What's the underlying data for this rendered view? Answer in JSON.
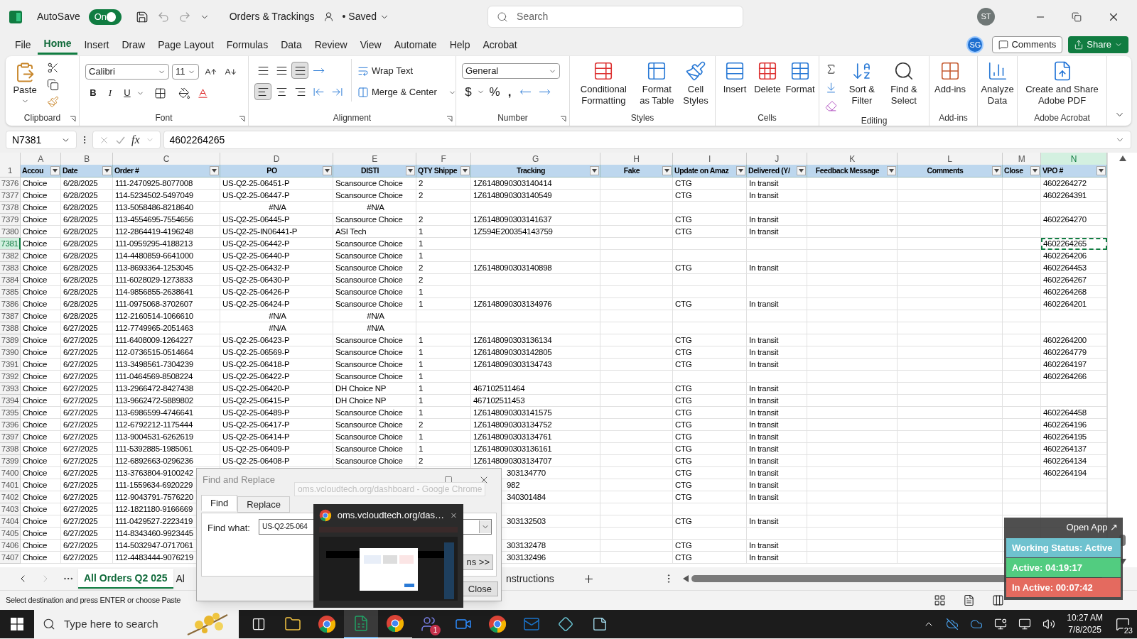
{
  "title_bar": {
    "autosave_label": "AutoSave",
    "autosave": {
      "label": "On",
      "on": true
    },
    "document_title": "Orders & Trackings",
    "save_status": "• Saved",
    "search": {
      "placeholder": "Search"
    },
    "user_initials": "ST"
  },
  "menu_tabs": [
    {
      "label": "File",
      "selected": false
    },
    {
      "label": "Home",
      "selected": true
    },
    {
      "label": "Insert",
      "selected": false
    },
    {
      "label": "Draw",
      "selected": false
    },
    {
      "label": "Page Layout",
      "selected": false
    },
    {
      "label": "Formulas",
      "selected": false
    },
    {
      "label": "Data",
      "selected": false
    },
    {
      "label": "Review",
      "selected": false
    },
    {
      "label": "View",
      "selected": false
    },
    {
      "label": "Automate",
      "selected": false
    },
    {
      "label": "Help",
      "selected": false
    },
    {
      "label": "Acrobat",
      "selected": false
    }
  ],
  "account": {
    "initials": "SG",
    "comments_button": "Comments",
    "share_button": "Share"
  },
  "ribbon": {
    "clipboard": {
      "label": "Clipboard",
      "paste": "Paste"
    },
    "font": {
      "label": "Font",
      "name": "Calibri",
      "size": "11",
      "bold": "B",
      "italic": "I",
      "underline": "U"
    },
    "alignment": {
      "label": "Alignment",
      "wrap_text": "Wrap Text",
      "merge": "Merge & Center"
    },
    "number": {
      "label": "Number",
      "format": "General",
      "currency": "$",
      "percent": "%",
      "comma": ","
    },
    "groups": [
      {
        "label": "Styles",
        "buttons": [
          "Conditional Formatting",
          "Format as Table",
          "Cell Styles"
        ]
      },
      {
        "label": "Cells",
        "buttons": [
          "Insert",
          "Delete",
          "Format"
        ]
      },
      {
        "label": "Editing",
        "buttons": [
          "Sort & Filter",
          "Find & Select"
        ]
      },
      {
        "label": "Add-ins",
        "buttons": [
          "Add-ins"
        ]
      },
      {
        "buttons": [
          "Analyze Data"
        ]
      },
      {
        "label": "Adobe Acrobat",
        "buttons": [
          "Create and Share Adobe PDF"
        ]
      }
    ]
  },
  "formula_bar": {
    "name_box": "N7381",
    "function_label": "fx",
    "value": "4602264265"
  },
  "sheet": {
    "header_row": "1",
    "columns": [
      {
        "letter": "A",
        "header": "Accou"
      },
      {
        "letter": "B",
        "header": "Date"
      },
      {
        "letter": "C",
        "header": "Order #"
      },
      {
        "letter": "D",
        "header": "PO"
      },
      {
        "letter": "E",
        "header": "DISTI"
      },
      {
        "letter": "F",
        "header": "QTY Shippe"
      },
      {
        "letter": "G",
        "header": "Tracking"
      },
      {
        "letter": "H",
        "header": "Fake"
      },
      {
        "letter": "I",
        "header": "Update on Amaz"
      },
      {
        "letter": "J",
        "header": "Delivered (Y/"
      },
      {
        "letter": "K",
        "header": "Feedback Message"
      },
      {
        "letter": "L",
        "header": "Comments"
      },
      {
        "letter": "M",
        "header": "Close"
      },
      {
        "letter": "N",
        "header": "VPO #"
      }
    ],
    "rows": [
      {
        "num": "7376",
        "kind": "normal",
        "selected": false,
        "cells": [
          "Choice",
          "6/28/2025",
          "111-2470925-8077008",
          "US-Q2-25-06451-P",
          "Scansource Choice",
          "2",
          "1Z6148090303140414",
          null,
          "CTG",
          "In transit",
          null,
          null,
          null,
          "4602264272"
        ]
      },
      {
        "num": "7377",
        "kind": "normal",
        "selected": false,
        "cells": [
          "Choice",
          "6/28/2025",
          "114-5234502-5497049",
          "US-Q2-25-06447-P",
          "Scansource Choice",
          "2",
          "1Z6148090303140549",
          null,
          "CTG",
          "In transit",
          null,
          null,
          null,
          "4602264391"
        ]
      },
      {
        "num": "7378",
        "kind": "na",
        "selected": false,
        "cells": [
          "Choice",
          "6/28/2025",
          "113-5058486-8218640",
          "#N/A",
          "#N/A",
          null,
          null,
          null,
          null,
          null,
          null,
          null,
          null,
          null
        ]
      },
      {
        "num": "7379",
        "kind": "normal",
        "selected": false,
        "cells": [
          "Choice",
          "6/28/2025",
          "113-4554695-7554656",
          "US-Q2-25-06445-P",
          "Scansource Choice",
          "2",
          "1Z6148090303141637",
          null,
          "CTG",
          "In transit",
          null,
          null,
          null,
          "4602264270"
        ]
      },
      {
        "num": "7380",
        "kind": "normal",
        "selected": false,
        "cells": [
          "Choice",
          "6/28/2025",
          "112-2864419-4196248",
          "US-Q2-25-IN06441-P",
          "ASI Tech",
          "1",
          "1Z594E200354143759",
          null,
          "CTG",
          "In transit",
          null,
          null,
          null,
          null
        ]
      },
      {
        "num": "7381",
        "kind": "normal",
        "selected": true,
        "cells": [
          "Choice",
          "6/28/2025",
          "111-0959295-4188213",
          "US-Q2-25-06442-P",
          "Scansource Choice",
          "1",
          null,
          null,
          null,
          null,
          null,
          null,
          null,
          "4602264265"
        ]
      },
      {
        "num": "7382",
        "kind": "normal",
        "selected": false,
        "cells": [
          "Choice",
          "6/28/2025",
          "114-4480859-6641000",
          "US-Q2-25-06440-P",
          "Scansource Choice",
          "1",
          null,
          null,
          null,
          null,
          null,
          null,
          null,
          "4602264206"
        ]
      },
      {
        "num": "7383",
        "kind": "normal",
        "selected": false,
        "cells": [
          "Choice",
          "6/28/2025",
          "113-8693364-1253045",
          "US-Q2-25-06432-P",
          "Scansource Choice",
          "2",
          "1Z6148090303140898",
          null,
          "CTG",
          "In transit",
          null,
          null,
          null,
          "4602264453"
        ]
      },
      {
        "num": "7384",
        "kind": "normal",
        "selected": false,
        "cells": [
          "Choice",
          "6/28/2025",
          "111-6028029-1273833",
          "US-Q2-25-06430-P",
          "Scansource Choice",
          "2",
          null,
          null,
          null,
          null,
          null,
          null,
          null,
          "4602264267"
        ]
      },
      {
        "num": "7385",
        "kind": "normal",
        "selected": false,
        "cells": [
          "Choice",
          "6/28/2025",
          "114-9856855-2638641",
          "US-Q2-25-06426-P",
          "Scansource Choice",
          "1",
          null,
          null,
          null,
          null,
          null,
          null,
          null,
          "4602264268"
        ]
      },
      {
        "num": "7386",
        "kind": "normal",
        "selected": false,
        "cells": [
          "Choice",
          "6/28/2025",
          "111-0975068-3702607",
          "US-Q2-25-06424-P",
          "Scansource Choice",
          "1",
          "1Z6148090303134976",
          null,
          "CTG",
          "In transit",
          null,
          null,
          null,
          "4602264201"
        ]
      },
      {
        "num": "7387",
        "kind": "na",
        "selected": false,
        "cells": [
          "Choice",
          "6/28/2025",
          "112-2160514-1066610",
          "#N/A",
          "#N/A",
          null,
          null,
          null,
          null,
          null,
          null,
          null,
          null,
          null
        ]
      },
      {
        "num": "7388",
        "kind": "na",
        "selected": false,
        "cells": [
          "Choice",
          "6/27/2025",
          "112-7749965-2051463",
          "#N/A",
          "#N/A",
          null,
          null,
          null,
          null,
          null,
          null,
          null,
          null,
          null
        ]
      },
      {
        "num": "7389",
        "kind": "normal",
        "selected": false,
        "cells": [
          "Choice",
          "6/27/2025",
          "111-6408009-1264227",
          "US-Q2-25-06423-P",
          "Scansource Choice",
          "1",
          "1Z6148090303136134",
          null,
          "CTG",
          "In transit",
          null,
          null,
          null,
          "4602264200"
        ]
      },
      {
        "num": "7390",
        "kind": "normal",
        "selected": false,
        "cells": [
          "Choice",
          "6/27/2025",
          "112-0736515-0514664",
          "US-Q2-25-06569-P",
          "Scansource Choice",
          "1",
          "1Z6148090303142805",
          null,
          "CTG",
          "In transit",
          null,
          null,
          null,
          "4602264779"
        ]
      },
      {
        "num": "7391",
        "kind": "normal",
        "selected": false,
        "cells": [
          "Choice",
          "6/27/2025",
          "113-3498561-7304239",
          "US-Q2-25-06418-P",
          "Scansource Choice",
          "1",
          "1Z6148090303134743",
          null,
          "CTG",
          "In transit",
          null,
          null,
          null,
          "4602264197"
        ]
      },
      {
        "num": "7392",
        "kind": "normal",
        "selected": false,
        "cells": [
          "Choice",
          "6/27/2025",
          "111-0464569-8508224",
          "US-Q2-25-06422-P",
          "Scansource Choice",
          "1",
          null,
          null,
          null,
          null,
          null,
          null,
          null,
          "4602264266"
        ]
      },
      {
        "num": "7393",
        "kind": "normal",
        "selected": false,
        "cells": [
          "Choice",
          "6/27/2025",
          "113-2966472-8427438",
          "US-Q2-25-06420-P",
          "DH Choice NP",
          "1",
          "467102511464",
          null,
          "CTG",
          "In transit",
          null,
          null,
          null,
          null
        ]
      },
      {
        "num": "7394",
        "kind": "normal",
        "selected": false,
        "cells": [
          "Choice",
          "6/27/2025",
          "113-9662472-5889802",
          "US-Q2-25-06415-P",
          "DH Choice NP",
          "1",
          "467102511453",
          null,
          "CTG",
          "In transit",
          null,
          null,
          null,
          null
        ]
      },
      {
        "num": "7395",
        "kind": "normal",
        "selected": false,
        "cells": [
          "Choice",
          "6/27/2025",
          "113-6986599-4746641",
          "US-Q2-25-06489-P",
          "Scansource Choice",
          "1",
          "1Z6148090303141575",
          null,
          "CTG",
          "In transit",
          null,
          null,
          null,
          "4602264458"
        ]
      },
      {
        "num": "7396",
        "kind": "normal",
        "selected": false,
        "cells": [
          "Choice",
          "6/27/2025",
          "112-6792212-1175444",
          "US-Q2-25-06417-P",
          "Scansource Choice",
          "2",
          "1Z6148090303134752",
          null,
          "CTG",
          "In transit",
          null,
          null,
          null,
          "4602264196"
        ]
      },
      {
        "num": "7397",
        "kind": "normal",
        "selected": false,
        "cells": [
          "Choice",
          "6/27/2025",
          "113-9004531-6262619",
          "US-Q2-25-06414-P",
          "Scansource Choice",
          "1",
          "1Z6148090303134761",
          null,
          "CTG",
          "In transit",
          null,
          null,
          null,
          "4602264195"
        ]
      },
      {
        "num": "7398",
        "kind": "normal",
        "selected": false,
        "cells": [
          "Choice",
          "6/27/2025",
          "111-5392885-1985061",
          "US-Q2-25-06409-P",
          "Scansource Choice",
          "1",
          "1Z6148090303136161",
          null,
          "CTG",
          "In transit",
          null,
          null,
          null,
          "4602264137"
        ]
      },
      {
        "num": "7399",
        "kind": "normal",
        "selected": false,
        "cells": [
          "Choice",
          "6/27/2025",
          "112-6892663-0296236",
          "US-Q2-25-06408-P",
          "Scansource Choice",
          "2",
          "1Z6148090303134707",
          null,
          "CTG",
          "In transit",
          null,
          null,
          null,
          "4602264134"
        ]
      },
      {
        "num": "7400",
        "kind": "covered",
        "selected": false,
        "cells": [
          "Choice",
          "6/27/2025",
          "113-3763804-9100242",
          null,
          null,
          null,
          "303134770",
          null,
          "CTG",
          "In transit",
          null,
          null,
          null,
          "4602264194"
        ]
      },
      {
        "num": "7401",
        "kind": "covered",
        "selected": false,
        "cells": [
          "Choice",
          "6/27/2025",
          "111-1559634-6920229",
          null,
          null,
          null,
          "982",
          null,
          "CTG",
          "In transit",
          null,
          null,
          null,
          null
        ]
      },
      {
        "num": "7402",
        "kind": "covered",
        "selected": false,
        "cells": [
          "Choice",
          "6/27/2025",
          "112-9043791-7576220",
          null,
          null,
          null,
          "340301484",
          null,
          "CTG",
          "In transit",
          null,
          null,
          null,
          null
        ]
      },
      {
        "num": "7403",
        "kind": "covered",
        "selected": false,
        "cells": [
          "Choice",
          "6/27/2025",
          "112-1821180-9166669",
          null,
          null,
          null,
          null,
          null,
          null,
          null,
          null,
          null,
          null,
          null
        ]
      },
      {
        "num": "7404",
        "kind": "covered",
        "selected": false,
        "cells": [
          "Choice",
          "6/27/2025",
          "111-0429527-2223419",
          null,
          null,
          null,
          "303132503",
          null,
          "CTG",
          "In transit",
          null,
          null,
          null,
          null
        ]
      },
      {
        "num": "7405",
        "kind": "covered",
        "selected": false,
        "cells": [
          "Choice",
          "6/27/2025",
          "114-8343460-9923445",
          null,
          null,
          null,
          null,
          null,
          null,
          null,
          null,
          null,
          null,
          null
        ]
      },
      {
        "num": "7406",
        "kind": "covered",
        "selected": false,
        "cells": [
          "Choice",
          "6/27/2025",
          "114-5032947-0717061",
          null,
          null,
          null,
          "303132478",
          null,
          "CTG",
          "In transit",
          null,
          null,
          null,
          null
        ]
      },
      {
        "num": "7407",
        "kind": "covered",
        "selected": false,
        "cells": [
          "Choice",
          "6/27/2025",
          "112-4483444-9076219",
          null,
          null,
          null,
          "303132496",
          null,
          "CTG",
          "In transit",
          null,
          null,
          null,
          null
        ]
      }
    ]
  },
  "sheet_tabs": [
    {
      "label": "All Orders Q2 025",
      "selected": true
    },
    {
      "label": "Al",
      "selected": false
    },
    {
      "label": "nstructions",
      "selected": false
    }
  ],
  "status_bar": {
    "message": "Select destination and press ENTER or choose Paste"
  },
  "find_dialog": {
    "title": "Find and Replace",
    "tooltip": "oms.vcloudtech.org/dashboard - Google Chrome",
    "tabs": [
      {
        "label": "Find",
        "selected": true
      },
      {
        "label": "Replace",
        "selected": false
      }
    ],
    "find_label": "Find what:",
    "find_value": "US-Q2-25-064",
    "options_button": "ns >>",
    "close_button": "Close"
  },
  "window_preview": {
    "title": "oms.vcloudtech.org/das…"
  },
  "status_widget": {
    "open_app": "Open App ↗",
    "items": [
      {
        "text": "Working Status: Active",
        "color": "#6fc2cf"
      },
      {
        "text": "Active: 04:19:17",
        "color": "#52cc80"
      },
      {
        "text": "In Active: 00:07:42",
        "color": "#e46a5f"
      }
    ]
  },
  "taskbar": {
    "search_placeholder": "Type here to search",
    "teams_badge": "1",
    "time": "10:27 AM",
    "date": "7/8/2025",
    "notifications": "23"
  }
}
